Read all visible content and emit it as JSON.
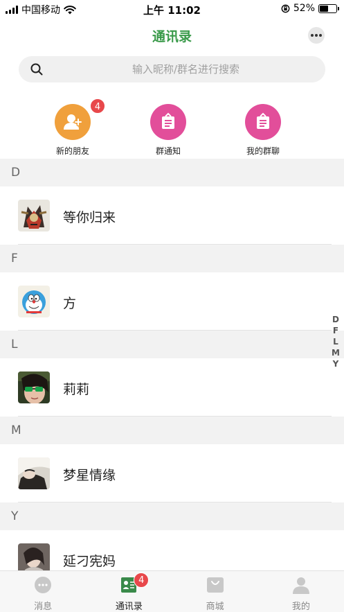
{
  "status_bar": {
    "carrier": "中国移动",
    "time": "上午 11:02",
    "battery": "52%",
    "battery_level": 0.52
  },
  "nav": {
    "title": "通讯录"
  },
  "search": {
    "placeholder": "输入昵称/群名进行搜索"
  },
  "quick_entries": [
    {
      "label": "新的朋友",
      "badge": "4",
      "icon": "add-user-icon",
      "color": "#f0a03c"
    },
    {
      "label": "群通知",
      "icon": "notice-icon",
      "color": "#e24e9a"
    },
    {
      "label": "我的群聊",
      "icon": "group-chat-icon",
      "color": "#e24e9a"
    }
  ],
  "sections": [
    {
      "letter": "D",
      "contacts": [
        {
          "name": "等你归来"
        }
      ]
    },
    {
      "letter": "F",
      "contacts": [
        {
          "name": "方"
        }
      ]
    },
    {
      "letter": "L",
      "contacts": [
        {
          "name": "莉莉"
        }
      ]
    },
    {
      "letter": "M",
      "contacts": [
        {
          "name": "梦星情缘"
        }
      ]
    },
    {
      "letter": "Y",
      "contacts": [
        {
          "name": "延刁宪妈"
        }
      ]
    }
  ],
  "alpha_index": [
    "D",
    "F",
    "L",
    "M",
    "Y"
  ],
  "tabbar": {
    "tabs": [
      {
        "label": "消息",
        "icon": "chat-bubble-icon"
      },
      {
        "label": "通讯录",
        "icon": "contacts-icon",
        "badge": "4",
        "active": true
      },
      {
        "label": "商城",
        "icon": "shopping-bag-icon"
      },
      {
        "label": "我的",
        "icon": "person-icon"
      }
    ]
  },
  "colors": {
    "accent": "#3a9a4a",
    "badge": "#e8484b",
    "orange": "#f0a03c",
    "pink": "#e24e9a"
  }
}
